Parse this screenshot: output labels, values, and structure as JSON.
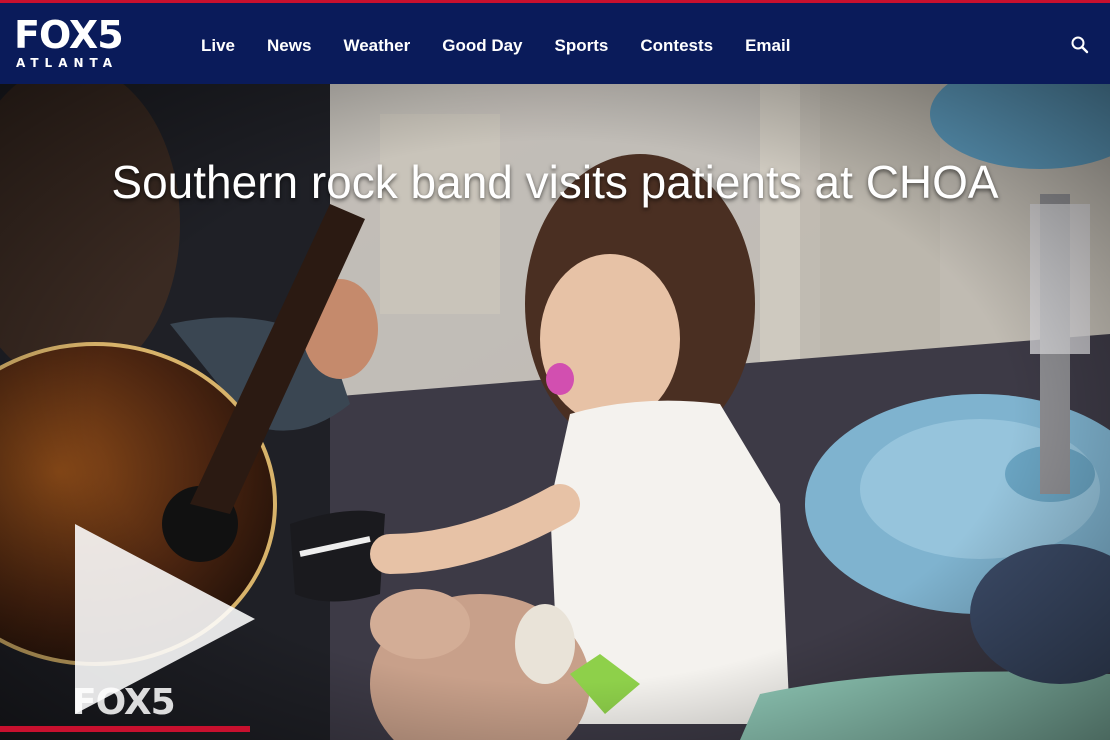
{
  "header": {
    "logo_main": "FOX5",
    "logo_sub": "ATLANTA",
    "nav": [
      "Live",
      "News",
      "Weather",
      "Good Day",
      "Sports",
      "Contests",
      "Email"
    ],
    "search_icon": "search-icon"
  },
  "video": {
    "headline": "Southern rock band visits patients at CHOA",
    "play_icon": "play-icon",
    "watermark": "FOX5"
  },
  "colors": {
    "brand_navy": "#0a1b5a",
    "brand_red": "#c8102e"
  }
}
